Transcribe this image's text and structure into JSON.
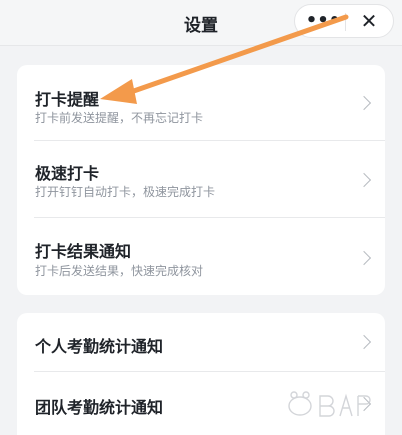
{
  "header": {
    "title": "设置",
    "more_icon": "more-icon",
    "close_icon": "close-icon",
    "more_glyph": "•••",
    "close_glyph": "✕"
  },
  "group1": {
    "items": [
      {
        "label": "打卡提醒",
        "desc": "打卡前发送提醒，不再忘记打卡"
      },
      {
        "label": "极速打卡",
        "desc": "打开钉钉自动打卡，极速完成打卡"
      },
      {
        "label": "打卡结果通知",
        "desc": "打卡后发送结果，快速完成核对"
      }
    ]
  },
  "group2": {
    "items": [
      {
        "label": "个人考勤统计通知"
      },
      {
        "label": "团队考勤统计通知"
      }
    ]
  },
  "annotation": {
    "arrow_color": "#f39a4b",
    "arrow_icon": "annotation-arrow-icon"
  },
  "watermark": {
    "icon": "baidu-watermark-icon"
  }
}
